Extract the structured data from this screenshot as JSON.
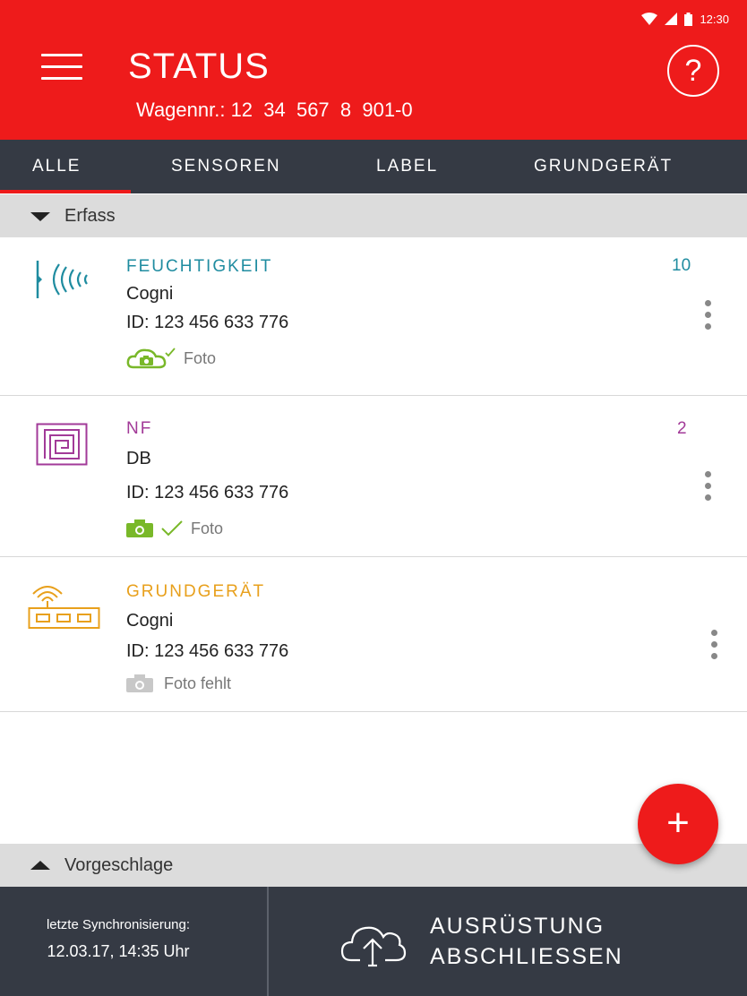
{
  "status_bar": {
    "time": "12:30"
  },
  "header": {
    "title": "STATUS",
    "subtitle": "Wagennr.: 12  34  567  8  901-0",
    "help_label": "?"
  },
  "tabs": [
    {
      "label": "ALLE",
      "active": true
    },
    {
      "label": "SENSOREN",
      "active": false
    },
    {
      "label": "LABEL",
      "active": false
    },
    {
      "label": "GRUNDGERÄT",
      "active": false
    }
  ],
  "sections": {
    "captured": "Erfass",
    "suggested": "Vorgeschlage"
  },
  "items": [
    {
      "type": "FEUCHTIGKEIT",
      "name": "Cogni",
      "id": "ID: 123 456 633 776",
      "count": "10",
      "photo": "Foto",
      "photo_status": "uploaded",
      "color": "#1f8ca0",
      "icon": "humidity-sensor-icon"
    },
    {
      "type": "NF",
      "name": "DB",
      "id": "ID: 123 456 633 776",
      "count": "2",
      "photo": "Foto",
      "photo_status": "taken",
      "color": "#a23a98",
      "icon": "nfc-label-icon"
    },
    {
      "type": "GRUNDGERÄT",
      "name": "Cogni",
      "id": "ID: 123 456 633 776",
      "count": "",
      "photo": "Foto fehlt",
      "photo_status": "missing",
      "color": "#e8a01c",
      "icon": "base-device-icon"
    }
  ],
  "fab": {
    "label": "+"
  },
  "footer": {
    "sync_label": "letzte Synchronisierung:",
    "sync_value": "12.03.17, 14:35 Uhr",
    "finish_line1": "AUSRÜSTUNG",
    "finish_line2": "ABSCHLIESSEN"
  },
  "colors": {
    "brand_red": "#ee1b1b",
    "dark_bar": "#353a44",
    "photo_green": "#79b829",
    "photo_missing": "#c8c8c8"
  }
}
